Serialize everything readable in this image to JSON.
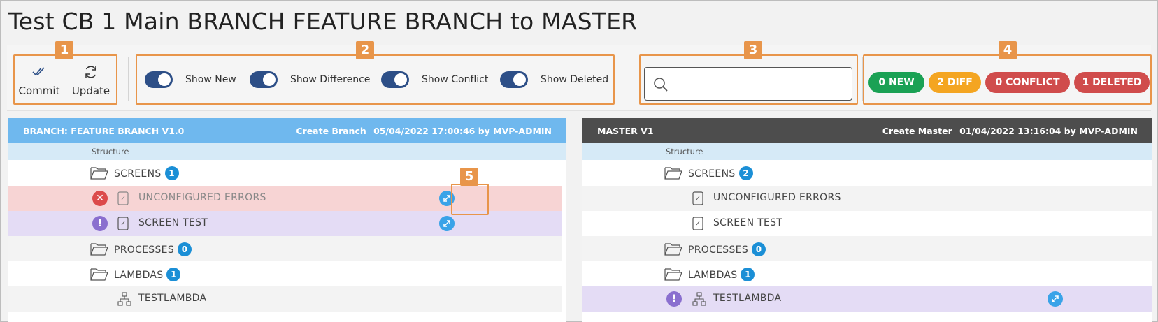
{
  "page": {
    "title": "Test CB 1 Main BRANCH FEATURE BRANCH to MASTER"
  },
  "callouts": [
    "1",
    "2",
    "3",
    "4",
    "5"
  ],
  "toolbar": {
    "commit_label": "Commit",
    "update_label": "Update",
    "toggles": [
      {
        "label": "Show New",
        "on": true
      },
      {
        "label": "Show Difference",
        "on": true
      },
      {
        "label": "Show Conflict",
        "on": true
      },
      {
        "label": "Show Deleted",
        "on": true
      }
    ],
    "search": {
      "value": "",
      "placeholder": ""
    },
    "summary": {
      "new": "0 NEW",
      "diff": "2 DIFF",
      "conflict": "0 CONFLICT",
      "deleted": "1 DELETED"
    }
  },
  "colors": {
    "accent_toggle": "#2d4f87",
    "callout": "#e8954a",
    "new": "#1aa154",
    "diff": "#f4a521",
    "conflict": "#d04c4c",
    "deleted": "#d04c4c",
    "branch_header": "#6fb8ee",
    "master_header": "#4d4d4d",
    "badge": "#1b8fd6"
  },
  "branch_panel": {
    "title": "BRANCH: FEATURE BRANCH V1.0",
    "meta_label": "Create Branch",
    "meta_value": "05/04/2022 17:00:46 by MVP-ADMIN",
    "structure_label": "Structure",
    "rows": [
      {
        "label": "SCREENS",
        "count": "1",
        "icon": "folder-icon"
      },
      {
        "label": "UNCONFIGURED ERRORS",
        "icon": "screen-file-icon",
        "status": "error",
        "expand": true
      },
      {
        "label": "SCREEN TEST",
        "icon": "screen-file-icon",
        "status": "conflict",
        "expand": true
      },
      {
        "label": "PROCESSES",
        "count": "0",
        "icon": "folder-icon"
      },
      {
        "label": "LAMBDAS",
        "count": "1",
        "icon": "folder-icon"
      },
      {
        "label": "TESTLAMBDA",
        "icon": "lambda-icon"
      }
    ]
  },
  "master_panel": {
    "title": "MASTER V1",
    "meta_label": "Create Master",
    "meta_value": "01/04/2022 13:16:04 by MVP-ADMIN",
    "structure_label": "Structure",
    "rows": [
      {
        "label": "SCREENS",
        "count": "2",
        "icon": "folder-icon"
      },
      {
        "label": "UNCONFIGURED ERRORS",
        "icon": "screen-file-icon"
      },
      {
        "label": "SCREEN TEST",
        "icon": "screen-file-icon"
      },
      {
        "label": "PROCESSES",
        "count": "0",
        "icon": "folder-icon"
      },
      {
        "label": "LAMBDAS",
        "count": "1",
        "icon": "folder-icon"
      },
      {
        "label": "TESTLAMBDA",
        "icon": "lambda-icon",
        "status": "conflict",
        "expand": true
      }
    ]
  }
}
